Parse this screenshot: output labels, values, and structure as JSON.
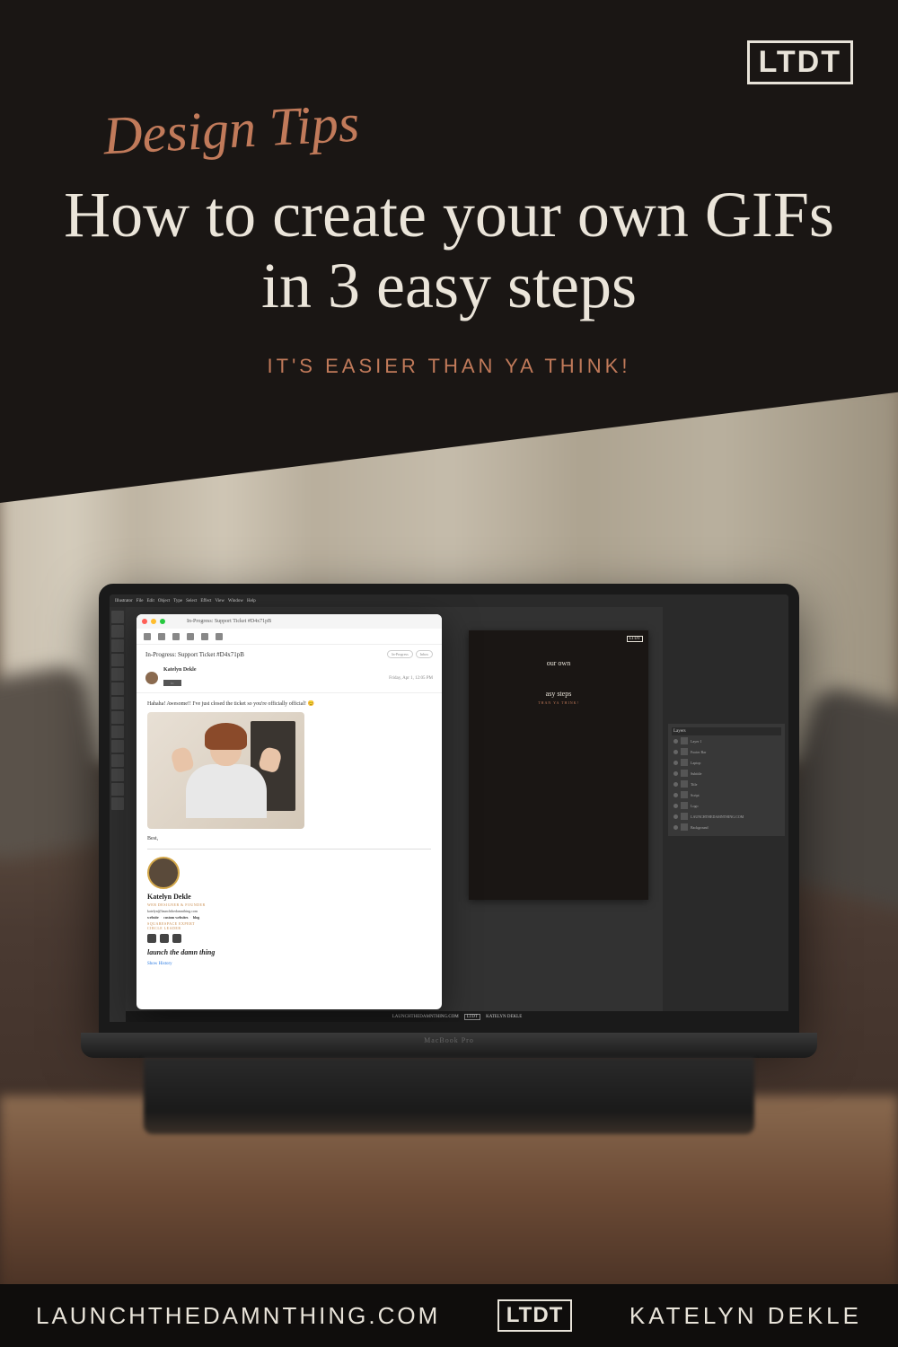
{
  "header": {
    "logo": "LTDT",
    "script": "Design Tips",
    "title": "How to create your own GIFs in 3 easy steps",
    "subtitle": "IT'S EASIER THAN YA THINK!"
  },
  "laptop": {
    "label": "MacBook Pro",
    "illustrator": {
      "app": "Illustrator",
      "menu": [
        "File",
        "Edit",
        "Object",
        "Type",
        "Select",
        "Effect",
        "View",
        "Window",
        "Help"
      ],
      "canvas_logo": "LTDT",
      "canvas_title_frag1": "our own",
      "canvas_title_frag2": "asy steps",
      "canvas_sub": "THAN YA THINK!",
      "bottom_url": "LAUNCHTHEDAMNTHING.COM",
      "bottom_logo": "LTDT",
      "bottom_name": "KATELYN DEKLE",
      "layers_header": "Layers",
      "layers": [
        "Layer 1",
        "Footer Bar",
        "Laptop",
        "Subtitle",
        "Title",
        "Script",
        "Logo",
        "LAUNCHTHEDAMNTHING.COM",
        "Background"
      ]
    },
    "email": {
      "tab_title": "In-Progress: Support Ticket #D4x71pB",
      "subject": "In-Progress: Support Ticket #D4x71pB",
      "badges": [
        "In-Progress",
        "Inbox"
      ],
      "from_name": "Katelyn Dekle",
      "to_label": "to:",
      "date": "Friday, Apr 1, 12:05 PM",
      "body_text": "Hahaha! Awesome!! I've just closed the ticket so you're officially official! 😊",
      "signoff": "Best,",
      "sig_name": "Katelyn Dekle",
      "sig_title": "WEB DESIGNER & FOUNDER",
      "sig_email": "katelyn@launchthedamnthing.com",
      "sig_link1": "website",
      "sig_link2": "custom websites",
      "sig_link3": "blog",
      "sig_tag1": "SQUARESPACE EXPERT",
      "sig_tag2": "CIRCLE LEADER",
      "sig_logo": "launch the damn thing",
      "show_history": "Show History"
    }
  },
  "footer": {
    "url": "LAUNCHTHEDAMNTHING.COM",
    "logo": "LTDT",
    "name": "KATELYN DEKLE"
  }
}
